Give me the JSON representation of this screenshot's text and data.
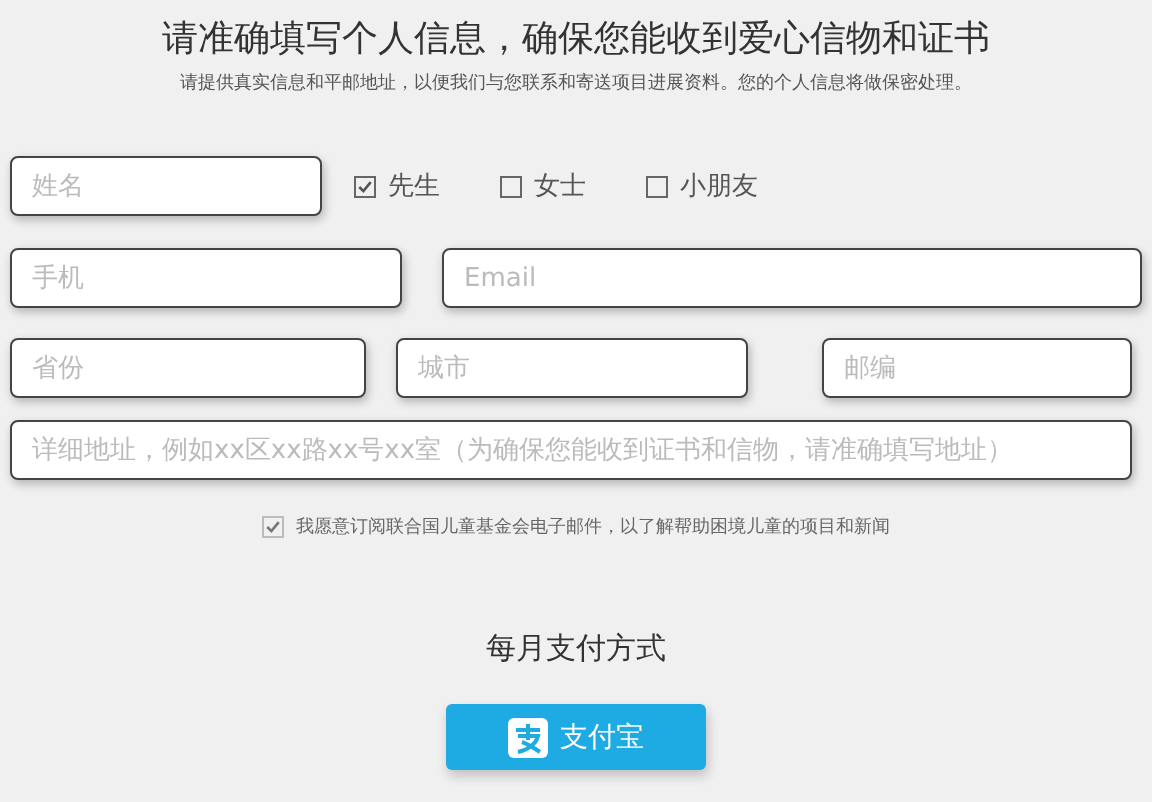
{
  "title": "请准确填写个人信息，确保您能收到爱心信物和证书",
  "subtitle": "请提供真实信息和平邮地址，以便我们与您联系和寄送项目进展资料。您的个人信息将做保密处理。",
  "name_field": {
    "placeholder": "姓名"
  },
  "salutations": [
    {
      "label": "先生",
      "checked": true
    },
    {
      "label": "女士",
      "checked": false
    },
    {
      "label": "小朋友",
      "checked": false
    }
  ],
  "phone_field": {
    "placeholder": "手机"
  },
  "email_field": {
    "placeholder": "Email"
  },
  "province_field": {
    "placeholder": "省份"
  },
  "city_field": {
    "placeholder": "城市"
  },
  "postcode_field": {
    "placeholder": "邮编"
  },
  "address_field": {
    "placeholder": "详细地址，例如xx区xx路xx号xx室（为确保您能收到证书和信物，请准确填写地址）"
  },
  "newsletter": {
    "label": "我愿意订阅联合国儿童基金会电子邮件，以了解帮助困境儿童的项目和新闻",
    "checked": true,
    "disabled": true
  },
  "payment_heading": "每月支付方式",
  "payment_button": {
    "label": "支付宝"
  }
}
